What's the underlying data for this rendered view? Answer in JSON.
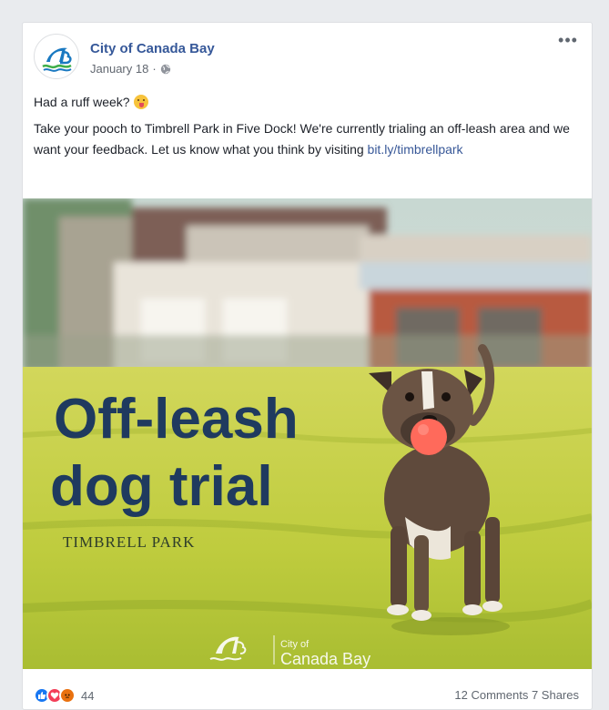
{
  "post": {
    "page_name": "City of Canada Bay",
    "date": "January 18",
    "date_separator": "·",
    "more_label": "•••",
    "line1": "Had a ruff week?",
    "line2": "Take your pooch to Timbrell Park in Five Dock! We're currently trialing an off-leash area and we want your feedback. Let us know what you think by visiting",
    "link": "bit.ly/timbrellpark"
  },
  "image": {
    "headline_1": "Off-leash",
    "headline_2": "dog trial",
    "subtitle": "TIMBRELL PARK",
    "logo_city": "City of",
    "logo_name": "Canada Bay",
    "colors": {
      "grass": "#c9d24c",
      "headline": "#1f3a5f",
      "ball": "#ff6a5b"
    }
  },
  "footer": {
    "reactions_count": "44",
    "comments": "12 Comments",
    "shares": "7 Shares"
  }
}
